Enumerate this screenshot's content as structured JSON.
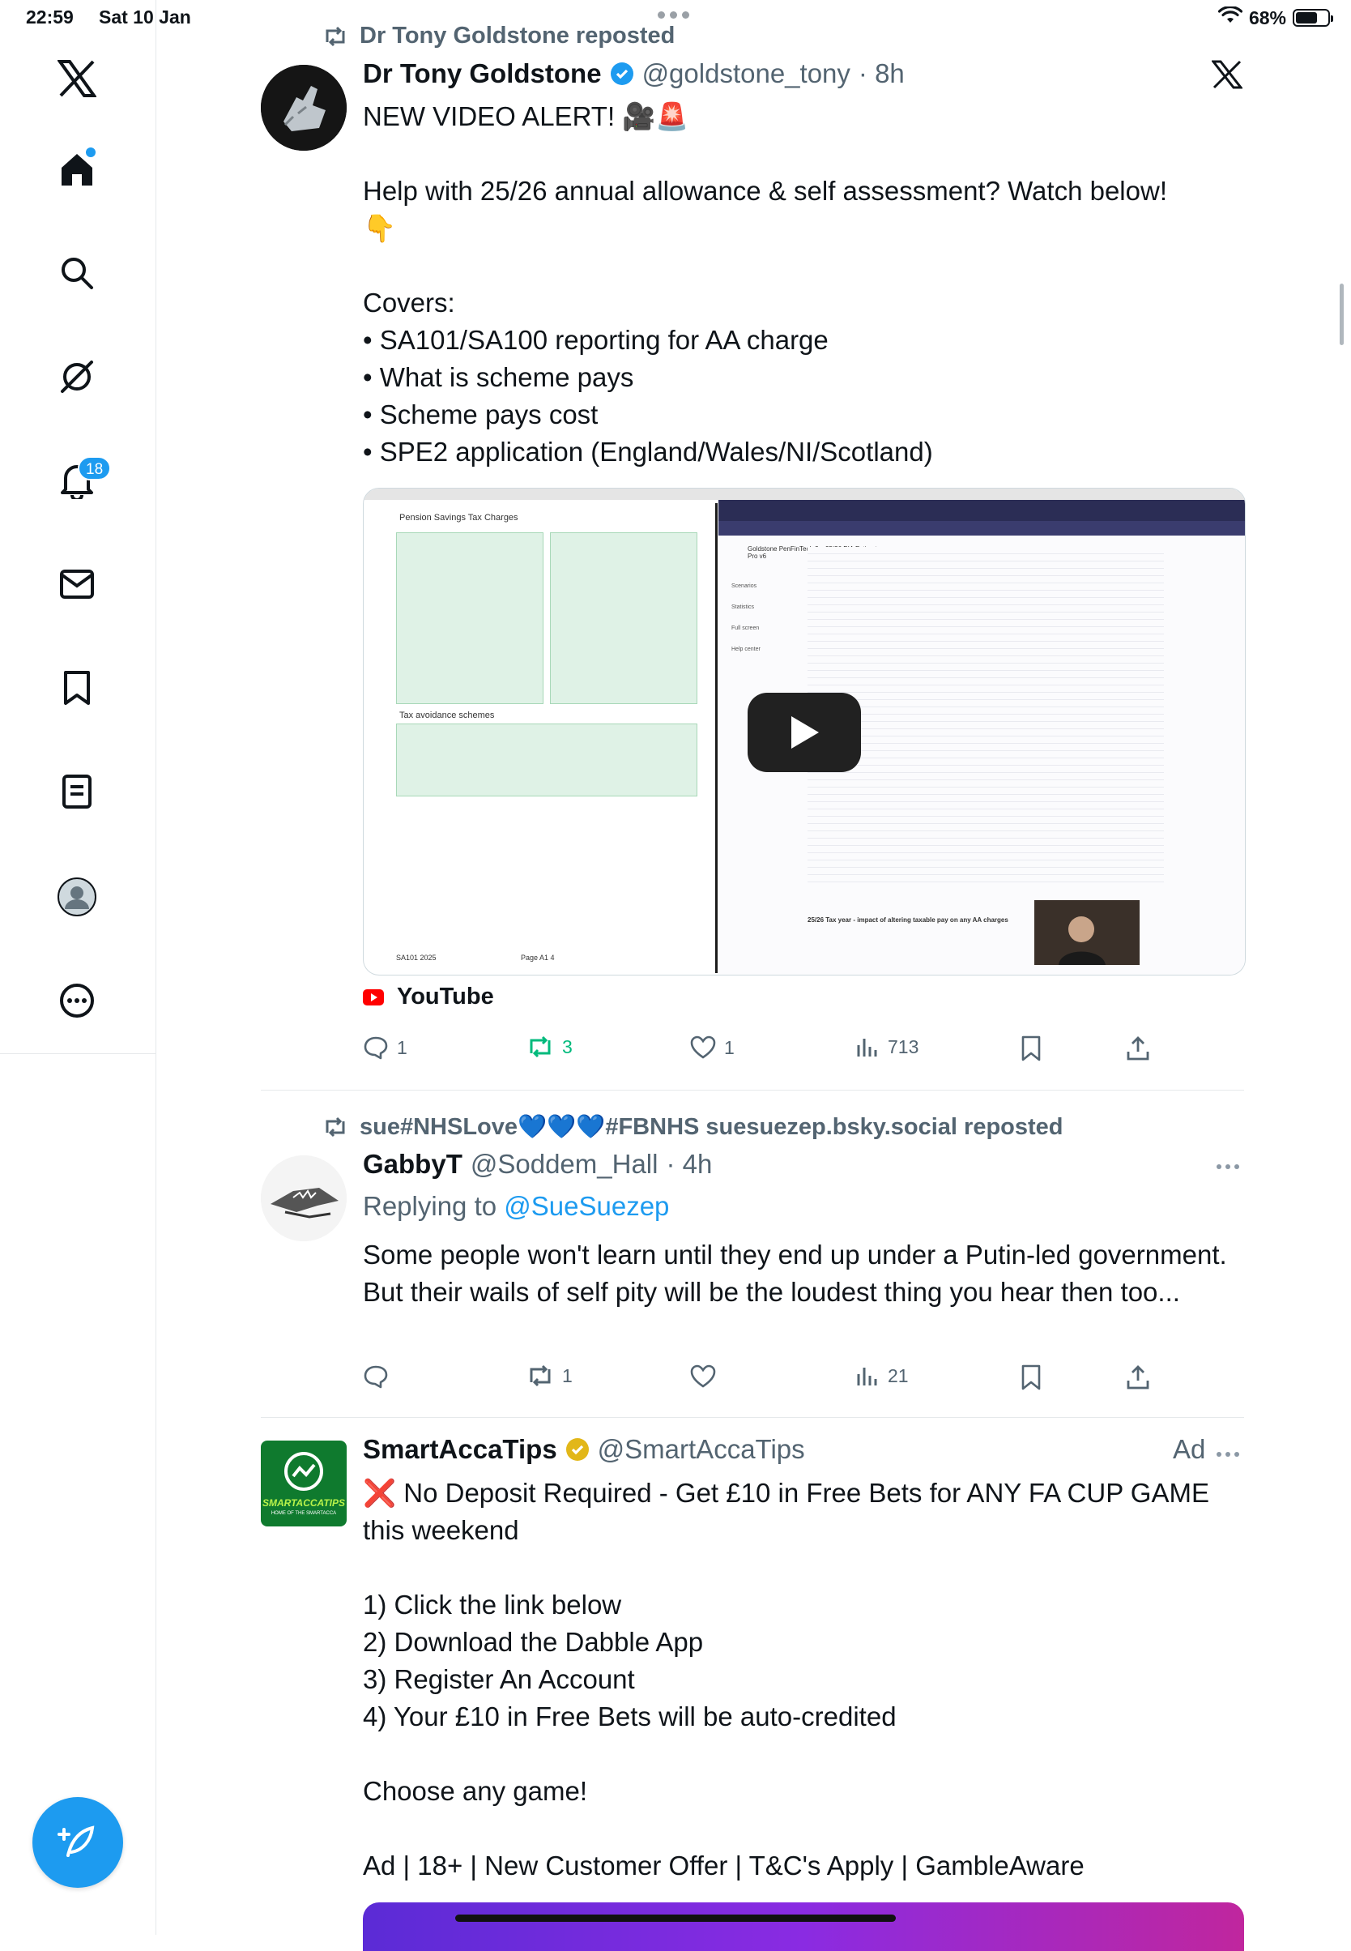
{
  "status_bar": {
    "time": "22:59",
    "date": "Sat 10 Jan",
    "battery": "68%",
    "battery_level": 0.68
  },
  "sidebar": {
    "items": [
      {
        "name": "x-logo"
      },
      {
        "name": "home"
      },
      {
        "name": "search"
      },
      {
        "name": "grok"
      },
      {
        "name": "notifications",
        "badge": "18"
      },
      {
        "name": "messages"
      },
      {
        "name": "bookmarks"
      },
      {
        "name": "lists"
      },
      {
        "name": "profile"
      },
      {
        "name": "more"
      }
    ]
  },
  "tweets": [
    {
      "repost_text": "Dr Tony Goldstone reposted",
      "name": "Dr Tony Goldstone",
      "handle": "@goldstone_tony",
      "time": "· 8h",
      "text_line1": "NEW VIDEO ALERT! 🎥🚨",
      "text_body": "Help with 25/26 annual allowance & self assessment? Watch below!\n👇\n\nCovers:\n• SA101/SA100 reporting for AA charge\n• What is scheme pays\n• Scheme pays cost\n• SPE2 application (England/Wales/NI/Scotland)",
      "media": {
        "left_title": "Pension Savings Tax Charges",
        "left_footer": "SA101 2025",
        "left_page": "Page A1 4",
        "left_section": "Tax avoidance schemes",
        "right_menu": [
          "Scenarios",
          "Statistics",
          "Full screen",
          "Help center"
        ],
        "right_heading": "Goldstone PenFinTech 3.x 25/26 PIA Estimator Pro v6",
        "right_section": "25/26 Tax year - impact of altering taxable pay on any AA charges"
      },
      "source": "YouTube",
      "replies": "1",
      "reposts": "3",
      "likes": "1",
      "views": "713"
    },
    {
      "repost_text": "sue#NHSLove💙💙💙#FBNHS suesuezep.bsky.social reposted",
      "name": "GabbyT",
      "handle": "@Soddem_Hall",
      "time": "· 4h",
      "replying_prefix": "Replying to ",
      "replying_to": "@SueSuezep",
      "text_body": "Some people won't learn until they end up under a Putin-led government. But their wails of self pity will be the loudest thing you hear then too...",
      "replies": "",
      "reposts": "1",
      "likes": "",
      "views": "21"
    },
    {
      "name": "SmartAccaTips",
      "handle": "@SmartAccaTips",
      "ad_label": "Ad",
      "avatar_text": "SMARTACCATIPS",
      "avatar_sub": "HOME OF THE SMARTACCA",
      "text_body": "❌ No Deposit Required - Get £10 in Free Bets for ANY FA CUP GAME this weekend\n\n1) Click the link below\n2) Download the Dabble App\n3) Register An Account\n4) Your £10 in Free Bets will be auto-credited\n\nChoose any game!\n\nAd | 18+ | New Customer Offer | T&C's Apply | GambleAware"
    }
  ]
}
